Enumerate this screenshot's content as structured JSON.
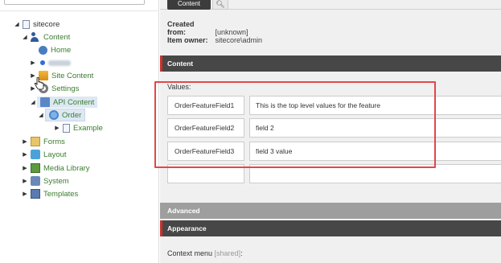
{
  "tree": {
    "root": "sitecore",
    "items": [
      {
        "label": "Content"
      },
      {
        "label": "Home"
      },
      {
        "label": ""
      },
      {
        "label": "Site Content"
      },
      {
        "label": "Settings"
      },
      {
        "label": "API Content"
      },
      {
        "label": "Order"
      },
      {
        "label": "Example"
      },
      {
        "label": "Forms"
      },
      {
        "label": "Layout"
      },
      {
        "label": "Media Library"
      },
      {
        "label": "System"
      },
      {
        "label": "Templates"
      }
    ]
  },
  "tabs": {
    "content": "Content",
    "search_icon": "search-icon"
  },
  "meta": {
    "created_from_label": "Created from:",
    "created_from_value": "[unknown]",
    "owner_label": "Item owner:",
    "owner_value": "sitecore\\admin"
  },
  "sections": {
    "content": "Content",
    "advanced": "Advanced",
    "appearance": "Appearance"
  },
  "values": {
    "label": "Values:",
    "rows": [
      {
        "key": "OrderFeatureField1",
        "value": "This is the top level values for the feature"
      },
      {
        "key": "OrderFeatureField2",
        "value": "field 2"
      },
      {
        "key": "OrderFeatureField3",
        "value": "field 3 value"
      },
      {
        "key": "",
        "value": ""
      }
    ]
  },
  "context_menu": {
    "label": "Context menu",
    "shared": "[shared]",
    "colon": ":"
  },
  "colors": {
    "accent_red": "#c9312b",
    "highlight_red": "#e2474a",
    "tree_green": "#3a7d2e"
  }
}
